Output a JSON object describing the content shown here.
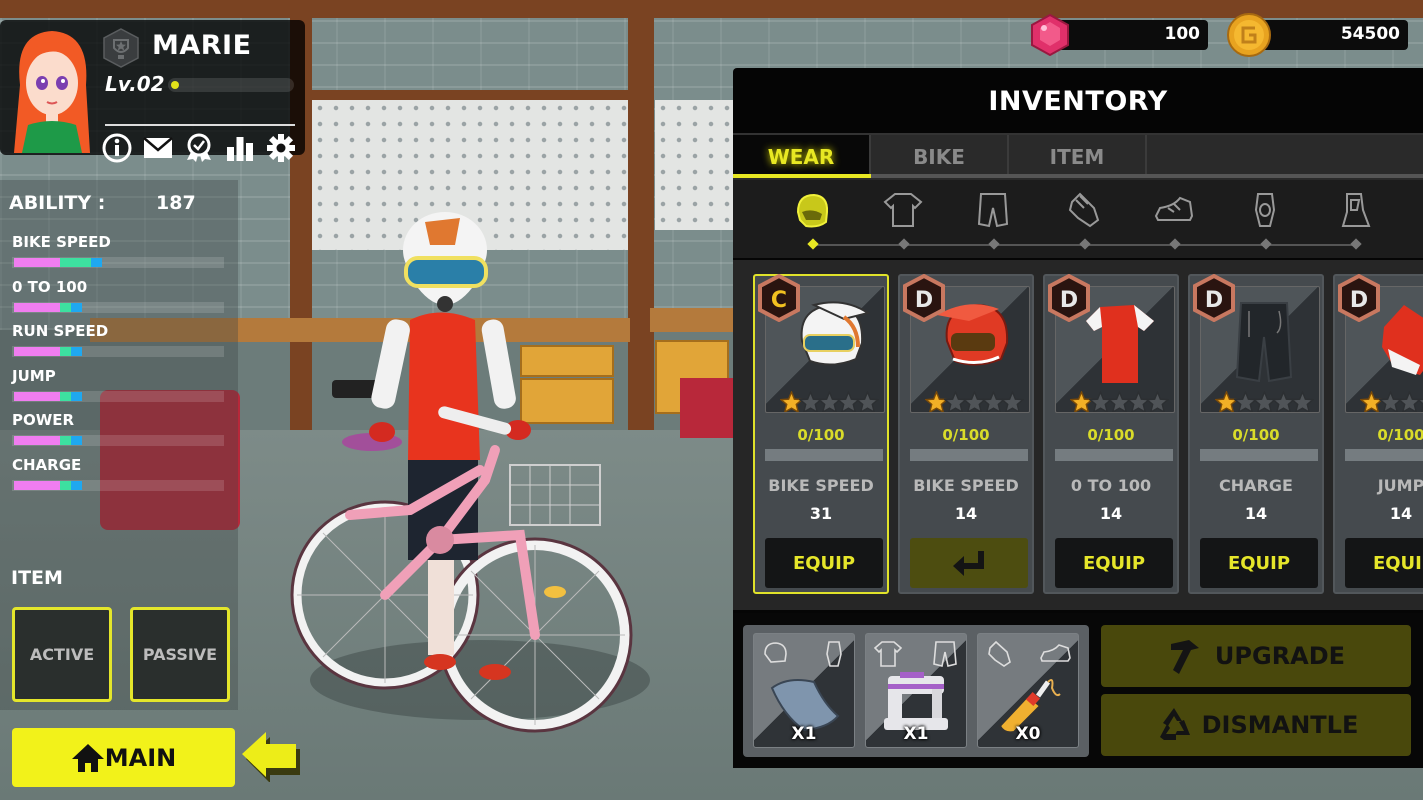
{
  "player": {
    "name": "MARIE",
    "level": "Lv.02",
    "level_progress": 0.02,
    "header_icons": [
      "info-icon",
      "mail-icon",
      "achievement-icon",
      "stats-icon",
      "settings-icon"
    ]
  },
  "currency": {
    "gems": "100",
    "gold": "54500"
  },
  "ability": {
    "label": "ABILITY :",
    "total": "187",
    "stats": [
      {
        "label": "BIKE SPEED",
        "segments": [
          0.33,
          0.22,
          0.08
        ]
      },
      {
        "label": "0 TO 100",
        "segments": [
          0.33,
          0.08,
          0.08
        ]
      },
      {
        "label": "RUN SPEED",
        "segments": [
          0.33,
          0.08,
          0.08
        ]
      },
      {
        "label": "JUMP",
        "segments": [
          0.33,
          0.08,
          0.08
        ]
      },
      {
        "label": "POWER",
        "segments": [
          0.33,
          0.08,
          0.08
        ]
      },
      {
        "label": "CHARGE",
        "segments": [
          0.33,
          0.08,
          0.08
        ]
      }
    ],
    "stat_colors": [
      "#f07df0",
      "#3de0a0",
      "#1fa8f0"
    ]
  },
  "items": {
    "title": "ITEM",
    "active_label": "ACTIVE",
    "passive_label": "PASSIVE"
  },
  "main_button": {
    "label": "MAIN"
  },
  "inventory": {
    "title": "INVENTORY",
    "tabs": [
      {
        "label": "WEAR",
        "active": true
      },
      {
        "label": "BIKE",
        "active": false
      },
      {
        "label": "ITEM",
        "active": false
      }
    ],
    "categories": [
      "helmet",
      "jersey",
      "pants",
      "gloves",
      "shoes",
      "knee-pad",
      "body-armor"
    ],
    "selected_category": "helmet",
    "cards": [
      {
        "grade": "C",
        "item": "white-helmet",
        "stars": 1,
        "max_stars": 5,
        "progress": "0/100",
        "stat": "BIKE SPEED",
        "value": "31",
        "action": "EQUIP",
        "selected": true
      },
      {
        "grade": "D",
        "item": "red-helmet",
        "stars": 1,
        "max_stars": 5,
        "progress": "0/100",
        "stat": "BIKE SPEED",
        "value": "14",
        "action": "return",
        "selected": false
      },
      {
        "grade": "D",
        "item": "red-jersey",
        "stars": 1,
        "max_stars": 5,
        "progress": "0/100",
        "stat": "0 TO 100",
        "value": "14",
        "action": "EQUIP",
        "selected": false
      },
      {
        "grade": "D",
        "item": "black-shorts",
        "stars": 1,
        "max_stars": 5,
        "progress": "0/100",
        "stat": "CHARGE",
        "value": "14",
        "action": "EQUIP",
        "selected": false
      },
      {
        "grade": "D",
        "item": "red-gloves",
        "stars": 1,
        "max_stars": 5,
        "progress": "0/100",
        "stat": "JUMP",
        "value": "14",
        "action": "EQUIP",
        "selected": false
      }
    ],
    "materials": [
      {
        "name": "fabric-plate",
        "for": [
          "helmet",
          "knee-pad"
        ],
        "count": "X1"
      },
      {
        "name": "sewing-machine",
        "for": [
          "jersey",
          "pants"
        ],
        "count": "X1"
      },
      {
        "name": "glue-tube",
        "for": [
          "gloves",
          "shoes"
        ],
        "count": "X0"
      }
    ],
    "upgrade_label": "UPGRADE",
    "dismantle_label": "DISMANTLE"
  },
  "colors": {
    "accent_yellow": "#e8e823",
    "main_button": "#f2f21a",
    "disabled_button": "#49480c"
  }
}
